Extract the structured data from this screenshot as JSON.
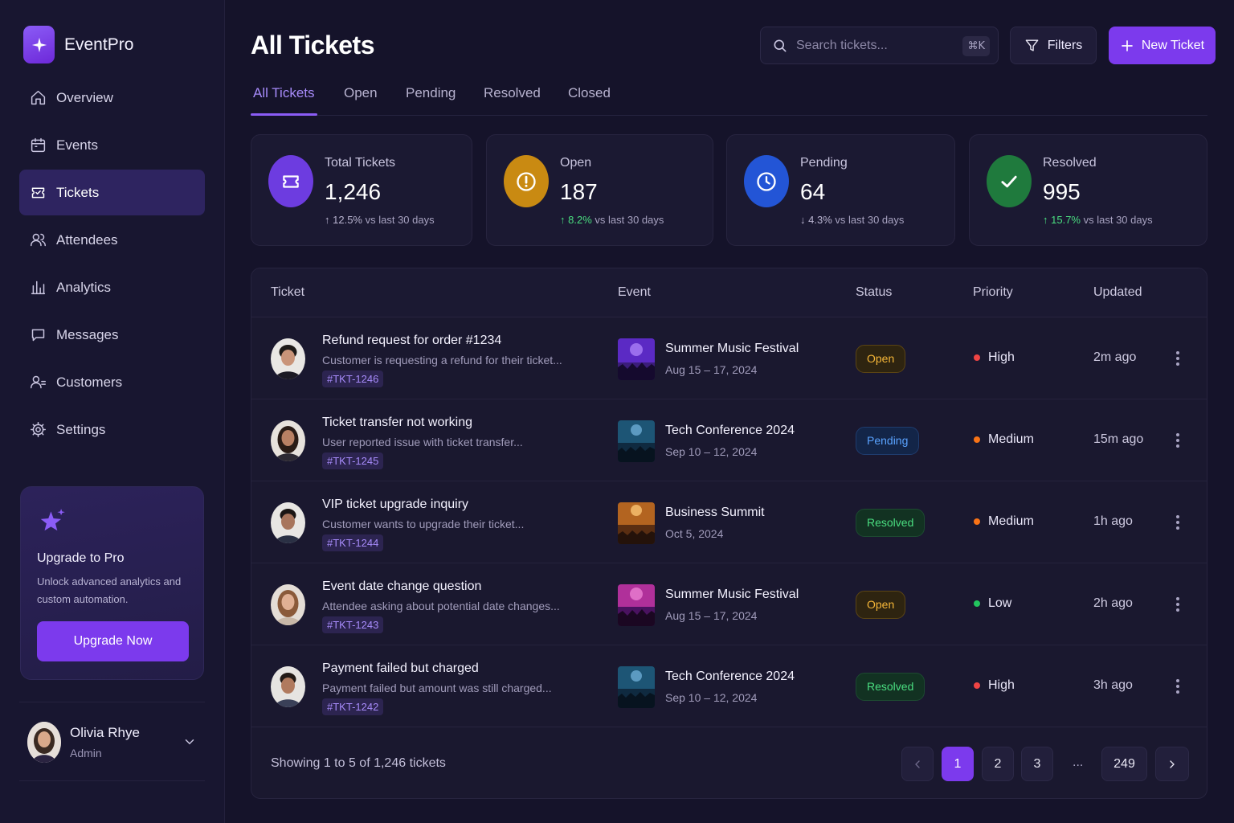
{
  "brand": {
    "name": "EventPro",
    "logo_icon": "sparkle-icon",
    "accent": "#7c3aed"
  },
  "sidebar": {
    "items": [
      {
        "label": "Overview",
        "icon": "home-icon",
        "active": false
      },
      {
        "label": "Events",
        "icon": "calendar-icon",
        "active": false
      },
      {
        "label": "Tickets",
        "icon": "ticket-icon",
        "active": true
      },
      {
        "label": "Attendees",
        "icon": "users-icon",
        "active": false
      },
      {
        "label": "Analytics",
        "icon": "bar-chart-icon",
        "active": false
      },
      {
        "label": "Messages",
        "icon": "message-icon",
        "active": false
      },
      {
        "label": "Customers",
        "icon": "user-group-icon",
        "active": false
      },
      {
        "label": "Settings",
        "icon": "gear-icon",
        "active": false
      }
    ],
    "upgrade": {
      "title": "Upgrade to Pro",
      "text": "Unlock advanced analytics and custom automation.",
      "button": "Upgrade Now"
    },
    "user": {
      "name": "Olivia Rhye",
      "role": "Admin"
    }
  },
  "header": {
    "title": "All Tickets",
    "search": {
      "placeholder": "Search tickets...",
      "shortcut": "⌘K"
    },
    "filters_label": "Filters",
    "new_ticket_label": "New Ticket"
  },
  "tabs": [
    {
      "label": "All Tickets",
      "active": true
    },
    {
      "label": "Open",
      "active": false
    },
    {
      "label": "Pending",
      "active": false
    },
    {
      "label": "Resolved",
      "active": false
    },
    {
      "label": "Closed",
      "active": false
    }
  ],
  "stats": [
    {
      "label": "Total Tickets",
      "value": "1,246",
      "arrow": "↑",
      "change": "12.5%",
      "suffix": "vs last 30 days",
      "trend": "neutral",
      "icon": "ticket-icon",
      "color": "#6d3ce0"
    },
    {
      "label": "Open",
      "value": "187",
      "arrow": "↑",
      "change": "8.2%",
      "suffix": "vs last 30 days",
      "trend": "up",
      "icon": "alert-icon",
      "color": "#c98a12"
    },
    {
      "label": "Pending",
      "value": "64",
      "arrow": "↓",
      "change": "4.3%",
      "suffix": "vs last 30 days",
      "trend": "neutral",
      "icon": "clock-icon",
      "color": "#2355d6"
    },
    {
      "label": "Resolved",
      "value": "995",
      "arrow": "↑",
      "change": "15.7%",
      "suffix": "vs last 30 days",
      "trend": "up",
      "icon": "check-icon",
      "color": "#1f7a3d"
    }
  ],
  "table": {
    "columns": [
      "Ticket",
      "Event",
      "Status",
      "Priority",
      "Updated"
    ],
    "rows": [
      {
        "title": "Refund request for order #1234",
        "desc": "Customer is requesting a refund for their ticket...",
        "id": "#TKT-1246",
        "event": "Summer Music Festival",
        "event_date": "Aug 15 – 17, 2024",
        "status": "Open",
        "status_kind": "open",
        "priority": "High",
        "priority_color": "#ef4444",
        "updated": "2m ago"
      },
      {
        "title": "Ticket transfer not working",
        "desc": "User reported issue with ticket transfer...",
        "id": "#TKT-1245",
        "event": "Tech Conference 2024",
        "event_date": "Sep 10 – 12, 2024",
        "status": "Pending",
        "status_kind": "pending",
        "priority": "Medium",
        "priority_color": "#f97316",
        "updated": "15m ago"
      },
      {
        "title": "VIP ticket upgrade inquiry",
        "desc": "Customer wants to upgrade their ticket...",
        "id": "#TKT-1244",
        "event": "Business Summit",
        "event_date": "Oct 5, 2024",
        "status": "Resolved",
        "status_kind": "resolved",
        "priority": "Medium",
        "priority_color": "#f97316",
        "updated": "1h ago"
      },
      {
        "title": "Event date change question",
        "desc": "Attendee asking about potential date changes...",
        "id": "#TKT-1243",
        "event": "Summer Music Festival",
        "event_date": "Aug 15 – 17, 2024",
        "status": "Open",
        "status_kind": "open",
        "priority": "Low",
        "priority_color": "#22c55e",
        "updated": "2h ago"
      },
      {
        "title": "Payment failed but charged",
        "desc": "Payment failed but amount was still charged...",
        "id": "#TKT-1242",
        "event": "Tech Conference 2024",
        "event_date": "Sep 10 – 12, 2024",
        "status": "Resolved",
        "status_kind": "resolved",
        "priority": "High",
        "priority_color": "#ef4444",
        "updated": "3h ago"
      }
    ],
    "footer": "Showing 1 to 5 of 1,246 tickets",
    "pagination": {
      "pages": [
        "1",
        "2",
        "3",
        "249"
      ],
      "ellipsis": "...",
      "current": "1"
    }
  }
}
